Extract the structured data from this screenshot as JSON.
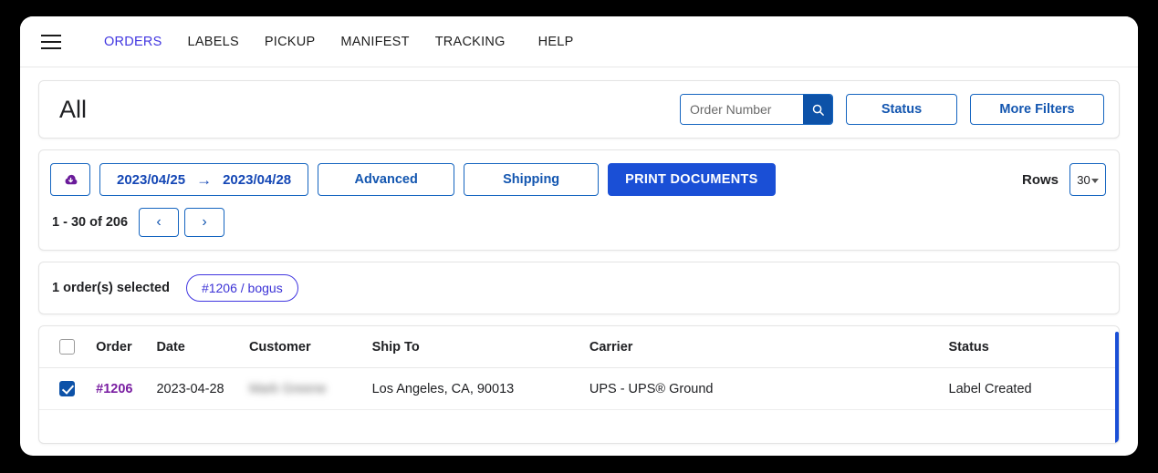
{
  "nav": {
    "menu_icon": "hamburger-menu-icon",
    "links": [
      {
        "label": "ORDERS",
        "active": true
      },
      {
        "label": "LABELS",
        "active": false
      },
      {
        "label": "PICKUP",
        "active": false
      },
      {
        "label": "MANIFEST",
        "active": false
      },
      {
        "label": "TRACKING",
        "active": false
      },
      {
        "label": "HELP",
        "active": false
      }
    ]
  },
  "header": {
    "title": "All",
    "search": {
      "placeholder": "Order Number",
      "value": "",
      "icon": "search-icon"
    },
    "status_button": "Status",
    "more_filters_button": "More Filters"
  },
  "toolbar": {
    "export_icon": "cloud-download-icon",
    "date_from": "2023/04/25",
    "date_to": "2023/04/28",
    "date_arrow": "→",
    "advanced_button": "Advanced",
    "shipping_button": "Shipping",
    "print_documents_button": "PRINT DOCUMENTS",
    "rows_label": "Rows",
    "rows_value": "30",
    "pagination_text": "1 - 30 of 206",
    "prev_icon": "‹",
    "next_icon": "›"
  },
  "selection": {
    "text": "1 order(s) selected",
    "chips": [
      "#1206 / bogus"
    ]
  },
  "table": {
    "columns": [
      "Order",
      "Date",
      "Customer",
      "Ship To",
      "Carrier",
      "Status"
    ],
    "select_all_checked": false,
    "rows": [
      {
        "checked": true,
        "order": "#1206",
        "date": "2023-04-28",
        "customer": "Mark Greene",
        "customer_redacted": true,
        "ship_to": "Los Angeles, CA, 90013",
        "carrier": "UPS - UPS® Ground",
        "status": "Label Created"
      }
    ]
  },
  "colors": {
    "accent_blue": "#1a4fd6",
    "link_blue": "#1356b0",
    "nav_active": "#4136e0",
    "search_btn": "#0d52a8",
    "chip_purple": "#3b32d6",
    "order_link": "#7a1fa2",
    "export_icon": "#6a1b9a",
    "page_background": "#000000"
  }
}
